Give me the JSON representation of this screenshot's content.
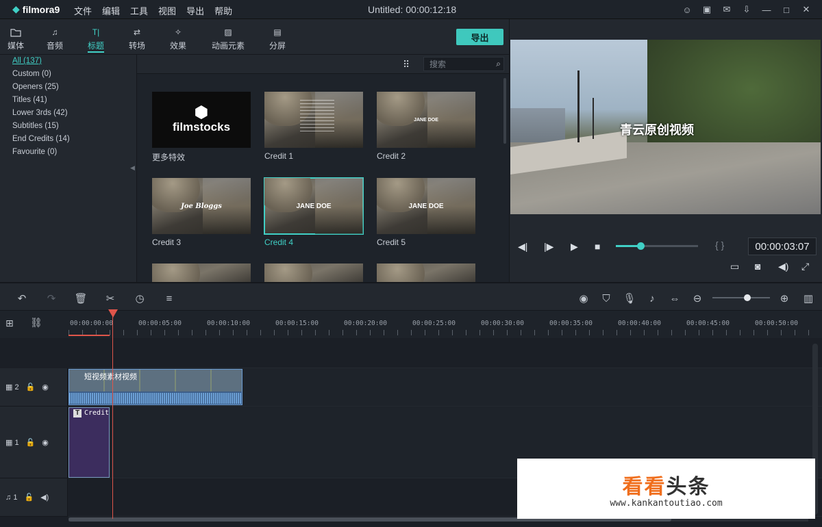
{
  "app": {
    "name": "filmora9",
    "title": "Untitled:  00:00:12:18"
  },
  "menu": [
    "文件",
    "编辑",
    "工具",
    "视图",
    "导出",
    "帮助"
  ],
  "window_icons": [
    "user-icon",
    "save-icon",
    "mail-icon",
    "download-icon",
    "minimize-icon",
    "maximize-icon",
    "close-icon"
  ],
  "lib_tabs": [
    {
      "label": "媒体",
      "icon": "folder-icon"
    },
    {
      "label": "音频",
      "icon": "music-icon"
    },
    {
      "label": "标题",
      "icon": "title-icon",
      "active": true
    },
    {
      "label": "转场",
      "icon": "transition-icon"
    },
    {
      "label": "效果",
      "icon": "effects-icon"
    },
    {
      "label": "动画元素",
      "icon": "elements-icon"
    },
    {
      "label": "分屏",
      "icon": "splitscreen-icon"
    }
  ],
  "export_label": "导出",
  "categories": [
    "All (137)",
    "Custom (0)",
    "Openers (25)",
    "Titles (41)",
    "Lower 3rds (42)",
    "Subtitles (15)",
    "End Credits (14)",
    "Favourite (0)"
  ],
  "search_placeholder": "搜索",
  "thumbnails": [
    {
      "label": "更多特效",
      "overlay": "filmstocks"
    },
    {
      "label": "Credit 1",
      "overlay": ""
    },
    {
      "label": "Credit 2",
      "overlay": "JANE DOE"
    },
    {
      "label": "Credit 3",
      "overlay": "Joe Bloggs"
    },
    {
      "label": "Credit 4",
      "overlay": "JANE DOE",
      "selected": true
    },
    {
      "label": "Credit 5",
      "overlay": "JANE DOE"
    }
  ],
  "preview": {
    "overlay_text": "青云原创视频",
    "timecode": "00:00:03:07",
    "progress": 0.3
  },
  "ruler_ticks": [
    "00:00:00:00",
    "00:00:05:00",
    "00:00:10:00",
    "00:00:15:00",
    "00:00:20:00",
    "00:00:25:00",
    "00:00:30:00",
    "00:00:35:00",
    "00:00:40:00",
    "00:00:45:00",
    "00:00:50:00"
  ],
  "tracks": [
    {
      "label": "2",
      "icon": "video-track-icon"
    },
    {
      "label": "1",
      "icon": "video-track-icon"
    },
    {
      "label": "1",
      "icon": "audio-track-icon"
    }
  ],
  "clips": {
    "video_clip": "短视频素材视频",
    "title_clip": "Credit"
  },
  "watermark": {
    "line1a": "看看",
    "line1b": "头条",
    "line2": "www.kankantoutiao.com"
  }
}
